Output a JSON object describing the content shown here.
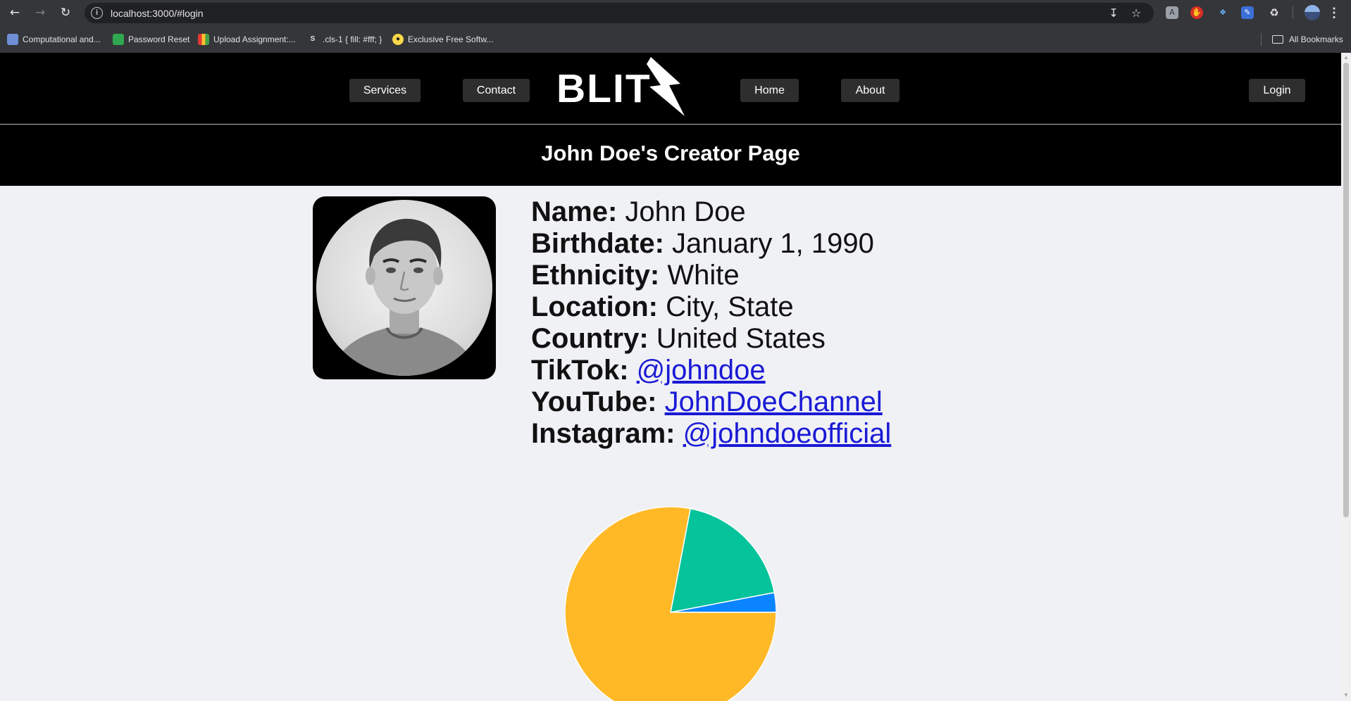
{
  "browser": {
    "url": "localhost:3000/#login",
    "bookmarks": [
      {
        "label": "Computational and..."
      },
      {
        "label": "Password Reset"
      },
      {
        "label": "Upload Assignment:..."
      },
      {
        "label": ".cls-1 { fill: #fff; }"
      },
      {
        "label": "Exclusive Free Softw..."
      }
    ],
    "all_bookmarks_label": "All Bookmarks"
  },
  "header": {
    "logo_text": "BLIT",
    "nav": {
      "services": "Services",
      "contact": "Contact",
      "home": "Home",
      "about": "About",
      "login": "Login"
    }
  },
  "banner": {
    "title": "John Doe's Creator Page"
  },
  "profile": {
    "fields": {
      "name": {
        "label": "Name:",
        "value": "John Doe"
      },
      "birthdate": {
        "label": "Birthdate:",
        "value": "January 1, 1990"
      },
      "ethnicity": {
        "label": "Ethnicity:",
        "value": "White"
      },
      "location": {
        "label": "Location:",
        "value": "City, State"
      },
      "country": {
        "label": "Country:",
        "value": "United States"
      },
      "tiktok": {
        "label": "TikTok:",
        "value": "@johndoe"
      },
      "youtube": {
        "label": "YouTube:",
        "value": "JohnDoeChannel"
      },
      "instagram": {
        "label": "Instagram:",
        "value": "@johndoeofficial"
      }
    }
  },
  "chart_data": {
    "type": "pie",
    "slices": [
      {
        "value": 0.03,
        "color": "#0a84ff"
      },
      {
        "value": 0.19,
        "color": "#05c39a"
      },
      {
        "value": 0.78,
        "color": "#ffb927"
      }
    ]
  }
}
